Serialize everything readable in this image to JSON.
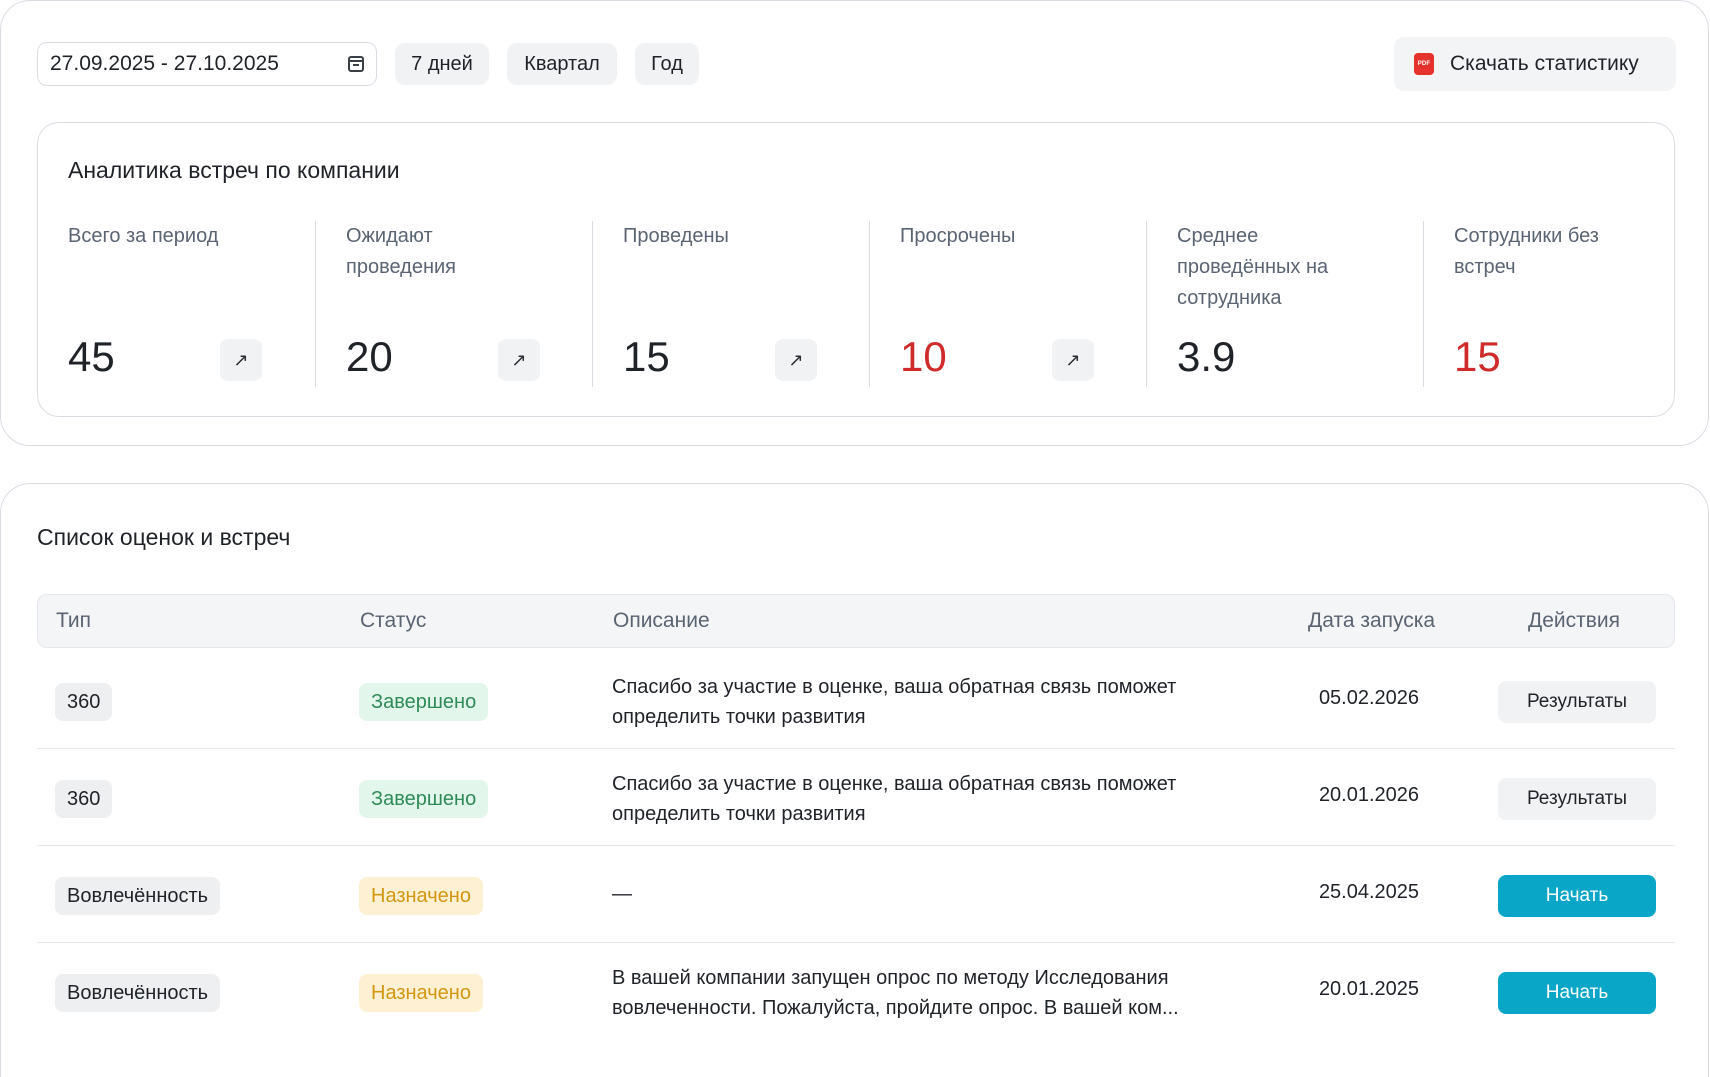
{
  "toolbar": {
    "date_range": "27.09.2025 - 27.10.2025",
    "periods": [
      "7 дней",
      "Квартал",
      "Год"
    ],
    "download_label": "Скачать статистику",
    "pdf_badge": "PDF"
  },
  "analytics": {
    "title": "Аналитика встреч по компании",
    "metrics": [
      {
        "label": "Всего за период",
        "value": "45"
      },
      {
        "label": "Ожидают проведения",
        "value": "20"
      },
      {
        "label": "Проведены",
        "value": "15"
      },
      {
        "label": "Просрочены",
        "value": "10"
      },
      {
        "label": "Среднее проведённых на сотрудника",
        "value": "3.9"
      },
      {
        "label": "Сотрудники без встреч",
        "value": "15"
      }
    ],
    "arrow_glyph": "↗"
  },
  "list": {
    "title": "Список оценок и встреч",
    "columns": [
      "Тип",
      "Статус",
      "Описание",
      "Дата запуска",
      "Действия"
    ],
    "rows": [
      {
        "type": "360",
        "status": "Завершено",
        "description": "Спасибо за участие в оценке, ваша обратная связь поможет определить точки развития",
        "date": "05.02.2026",
        "action": "Результаты"
      },
      {
        "type": "360",
        "status": "Завершено",
        "description": "Спасибо за участие в оценке, ваша обратная связь поможет определить точки развития",
        "date": "20.01.2026",
        "action": "Результаты"
      },
      {
        "type": "Вовлечённость",
        "status": "Назначено",
        "description": "—",
        "date": "25.04.2025",
        "action": "Начать"
      },
      {
        "type": "Вовлечённость",
        "status": "Назначено",
        "description": "В вашей компании запущен опрос по методу Исследования вовлеченности. Пожалуйста, пройдите опрос. В вашей ком...",
        "date": "20.01.2025",
        "action": "Начать"
      }
    ]
  },
  "colors": {
    "accent": "#0aa6c8",
    "danger": "#d02b2b",
    "status_done": "#2e8b57",
    "status_assigned": "#d49710"
  }
}
